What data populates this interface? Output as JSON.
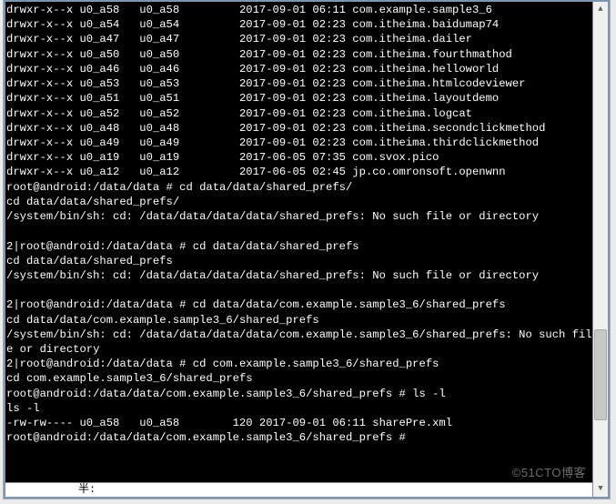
{
  "watermark": "©51CTO博客",
  "statusbar_text": "半:",
  "listing": [
    {
      "perm": "drwxr-x--x",
      "owner": "u0_a58",
      "group": "u0_a58",
      "size": "",
      "date": "2017-09-01",
      "time": "06:11",
      "name": "com.example.sample3_6"
    },
    {
      "perm": "drwxr-x--x",
      "owner": "u0_a54",
      "group": "u0_a54",
      "size": "",
      "date": "2017-09-01",
      "time": "02:23",
      "name": "com.itheima.baidumap74"
    },
    {
      "perm": "drwxr-x--x",
      "owner": "u0_a47",
      "group": "u0_a47",
      "size": "",
      "date": "2017-09-01",
      "time": "02:23",
      "name": "com.itheima.dailer"
    },
    {
      "perm": "drwxr-x--x",
      "owner": "u0_a50",
      "group": "u0_a50",
      "size": "",
      "date": "2017-09-01",
      "time": "02:23",
      "name": "com.itheima.fourthmathod"
    },
    {
      "perm": "drwxr-x--x",
      "owner": "u0_a46",
      "group": "u0_a46",
      "size": "",
      "date": "2017-09-01",
      "time": "02:23",
      "name": "com.itheima.helloworld"
    },
    {
      "perm": "drwxr-x--x",
      "owner": "u0_a53",
      "group": "u0_a53",
      "size": "",
      "date": "2017-09-01",
      "time": "02:23",
      "name": "com.itheima.htmlcodeviewer"
    },
    {
      "perm": "drwxr-x--x",
      "owner": "u0_a51",
      "group": "u0_a51",
      "size": "",
      "date": "2017-09-01",
      "time": "02:23",
      "name": "com.itheima.layoutdemo"
    },
    {
      "perm": "drwxr-x--x",
      "owner": "u0_a52",
      "group": "u0_a52",
      "size": "",
      "date": "2017-09-01",
      "time": "02:23",
      "name": "com.itheima.logcat"
    },
    {
      "perm": "drwxr-x--x",
      "owner": "u0_a48",
      "group": "u0_a48",
      "size": "",
      "date": "2017-09-01",
      "time": "02:23",
      "name": "com.itheima.secondclickmethod"
    },
    {
      "perm": "drwxr-x--x",
      "owner": "u0_a49",
      "group": "u0_a49",
      "size": "",
      "date": "2017-09-01",
      "time": "02:23",
      "name": "com.itheima.thirdclickmethod"
    },
    {
      "perm": "drwxr-x--x",
      "owner": "u0_a19",
      "group": "u0_a19",
      "size": "",
      "date": "2017-06-05",
      "time": "07:35",
      "name": "com.svox.pico"
    },
    {
      "perm": "drwxr-x--x",
      "owner": "u0_a12",
      "group": "u0_a12",
      "size": "",
      "date": "2017-06-05",
      "time": "02:45",
      "name": "jp.co.omronsoft.openwnn"
    }
  ],
  "commands": [
    "root@android:/data/data # cd data/data/shared_prefs/",
    "cd data/data/shared_prefs/",
    "/system/bin/sh: cd: /data/data/data/data/shared_prefs: No such file or directory",
    "",
    "2|root@android:/data/data # cd data/data/shared_prefs",
    "cd data/data/shared_prefs",
    "/system/bin/sh: cd: /data/data/data/data/shared_prefs: No such file or directory",
    "",
    "2|root@android:/data/data # cd data/data/com.example.sample3_6/shared_prefs",
    "cd data/data/com.example.sample3_6/shared_prefs",
    "/system/bin/sh: cd: /data/data/data/data/com.example.sample3_6/shared_prefs: No such file or directory",
    "2|root@android:/data/data # cd com.example.sample3_6/shared_prefs",
    "cd com.example.sample3_6/shared_prefs",
    "root@android:/data/data/com.example.sample3_6/shared_prefs # ls -l",
    "ls -l",
    "-rw-rw---- u0_a58   u0_a58        120 2017-09-01 06:11 sharePre.xml",
    "root@android:/data/data/com.example.sample3_6/shared_prefs #"
  ],
  "layout": {
    "perm_w": 11,
    "owner_w": 9,
    "group_w": 15,
    "date_w": 11,
    "time_w": 6
  },
  "wrap_col": 88
}
